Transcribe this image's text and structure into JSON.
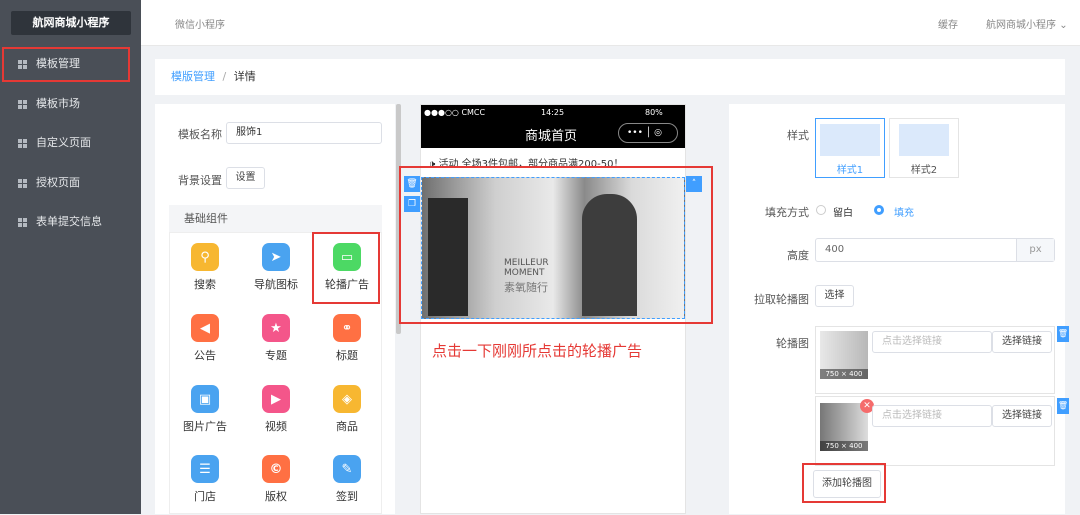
{
  "sidebar": {
    "logo": "航网商城小程序",
    "items": [
      "模板管理",
      "模板市场",
      "自定义页面",
      "授权页面",
      "表单提交信息"
    ]
  },
  "topbar": {
    "left": "微信小程序",
    "save": "缓存",
    "account": "航网商城小程序"
  },
  "breadcrumb": {
    "parent": "模版管理",
    "sep": "/",
    "current": "详情"
  },
  "left": {
    "name_label": "模板名称",
    "name_value": "服饰1",
    "bg_label": "背景设置",
    "bg_button": "设置",
    "section": "基础组件",
    "components": [
      "搜索",
      "导航图标",
      "轮播广告",
      "公告",
      "专题",
      "标题",
      "图片广告",
      "视频",
      "商品",
      "门店",
      "版权",
      "签到"
    ]
  },
  "phone": {
    "status_left": "●●●○○ CMCC",
    "status_time": "14:25",
    "status_right": "80%",
    "title": "商城首页",
    "notice": "活动  全场3件包邮，部分商品满200-50！",
    "banner_text1": "MEILLEUR",
    "banner_text2": "MOMENT",
    "banner_text3": "素氧随行"
  },
  "annotation": "点击一下刚刚所点击的轮播广告",
  "right": {
    "style_label": "样式",
    "style1": "样式1",
    "style2": "样式2",
    "fill_label": "填充方式",
    "fill_opt1": "留白",
    "fill_opt2": "填充",
    "height_label": "高度",
    "height_value": "400",
    "height_unit": "px",
    "pull_label": "拉取轮播图",
    "pull_button": "选择",
    "carousel_label": "轮播图",
    "link_placeholder": "点击选择链接",
    "link_button": "选择链接",
    "thumb_size": "750 × 400",
    "add_button": "添加轮播图"
  }
}
